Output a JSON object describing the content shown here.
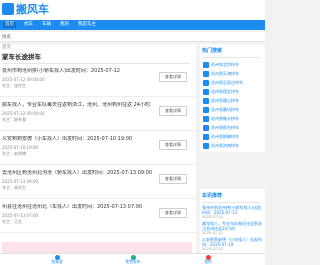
{
  "header": {
    "logo_text": "搬风车"
  },
  "nav": [
    "首页",
    "找车",
    "车辆",
    "我的",
    "我是车主"
  ],
  "search": {
    "placeholder": "搜索"
  },
  "main": {
    "breadcrumb": "首页",
    "title": "家车长途拼车",
    "button_label": "查看详情",
    "rows": [
      {
        "title": "泉州市到沧州拼(小轿车找人)出发时间：2025-07-12",
        "meta1": "2025-07-12 09:00:00",
        "meta2": "车主：张先生"
      },
      {
        "title": "顺车找人，专业车队每天往返到浙江，沧州、沧州到州往返 24小时...",
        "meta1": "2025-07-12 09:00:00",
        "meta2": "车主：联系我"
      },
      {
        "title": "义安到到安德（小车找人）出发时间：2025-07-10 19:00",
        "meta1": "2025-07-10 19:00",
        "meta2": "车主：赵师傅"
      },
      {
        "title": "去沧州区到沧州北沟沧（轿车找人）出发时间：2025-07-13 09:00",
        "meta1": "2025-07-13 09:00",
        "meta2": "车主：周先生"
      },
      {
        "title": "州县往沧州往沧州北（车找人）出发时间：2025-07-13 07:00",
        "meta1": "2025-07-13 07:00",
        "meta2": "车主：王先"
      }
    ]
  },
  "sidebar": {
    "hot_title": "热门搜索",
    "hot_items": [
      "沧州到北京拼车",
      "沧州到天津拼车",
      "沧州到石家庄拼车",
      "沧州到保定拼车",
      "沧州到唐山拼车",
      "沧州到廊坊拼车",
      "沧州到衡水拼车",
      "沧州到邢台拼车",
      "沧州到邯郸拼车",
      "沧州到济南拼车"
    ],
    "rec_title": "车讯推荐",
    "rec_items": [
      {
        "title": "泉州市到沧州拼(小轿车找人)出发时间：2025-07-12",
        "date": "2025-07-12"
      },
      {
        "title": "顺车找人，专业车队每天往返到浙江沧州往返24小时",
        "date": "2025-07-12"
      },
      {
        "title": "义安到到安德（小车找人）出发时间：2025-07-10",
        "date": "2025-07-10"
      }
    ]
  },
  "tabs": [
    {
      "label": "找乘客",
      "color": "#1c8cf0"
    },
    {
      "label": "免费发布",
      "color": "#1ab394"
    },
    {
      "label": "我的",
      "color": "#e8413c"
    }
  ]
}
